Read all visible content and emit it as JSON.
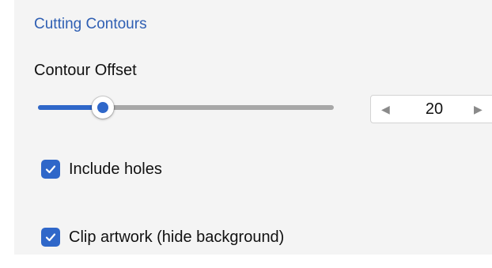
{
  "section": {
    "title": "Cutting Contours"
  },
  "contour_offset": {
    "label": "Contour Offset",
    "slider_fraction": 0.22,
    "value": "20",
    "decrement_icon": "triangle-left-icon",
    "increment_icon": "triangle-right-icon"
  },
  "options": {
    "include_holes": {
      "label": "Include holes",
      "checked": true
    },
    "clip_artwork": {
      "label": "Clip artwork (hide background)",
      "checked": true
    }
  },
  "colors": {
    "accent": "#2f67c9",
    "section_title": "#2f5fb3",
    "panel_background": "#f4f4f4"
  }
}
